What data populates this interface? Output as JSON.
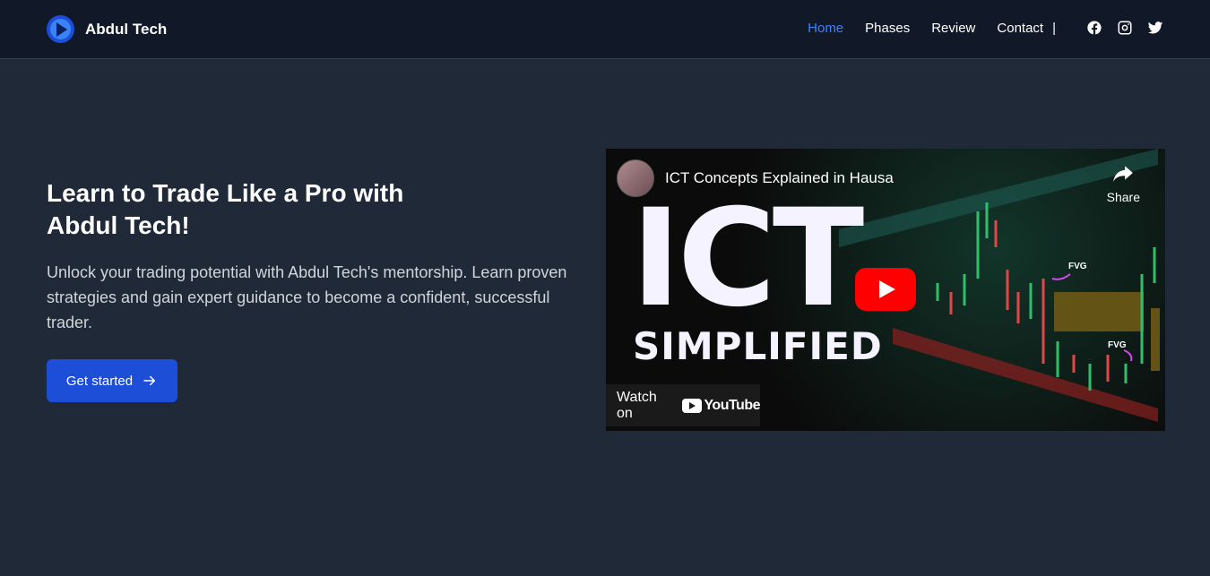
{
  "brand": {
    "name": "Abdul Tech"
  },
  "nav": {
    "items": [
      {
        "label": "Home",
        "active": true
      },
      {
        "label": "Phases",
        "active": false
      },
      {
        "label": "Review",
        "active": false
      },
      {
        "label": "Contact",
        "active": false
      }
    ],
    "separator": "|",
    "social_icons": [
      "facebook-icon",
      "instagram-icon",
      "twitter-icon"
    ]
  },
  "hero": {
    "title": "Learn to Trade Like a Pro with Abdul Tech!",
    "description": "Unlock your trading potential with Abdul Tech's mentorship. Learn proven strategies and gain expert guidance to become a confident, successful trader.",
    "cta_label": "Get started"
  },
  "video": {
    "title": "ICT Concepts Explained in Hausa",
    "share_label": "Share",
    "thumbnail_big": "ICT",
    "thumbnail_sub": "SIMPLIFIED",
    "fvg_label_1": "FVG",
    "fvg_label_2": "FVG",
    "watch_on": "Watch on",
    "youtube_word": "YouTube"
  },
  "colors": {
    "accent": "#3b82f6",
    "button": "#1d4ed8",
    "background": "#1f2937",
    "header": "#111827"
  }
}
